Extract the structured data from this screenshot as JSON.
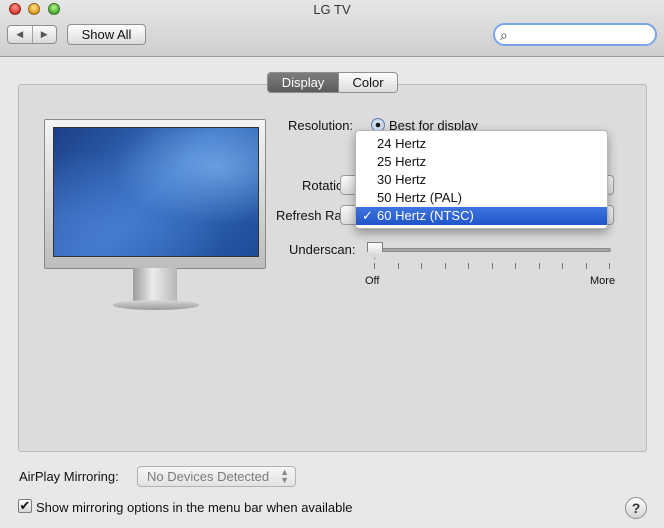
{
  "window": {
    "title": "LG TV"
  },
  "toolbar": {
    "back_glyph": "◀",
    "forward_glyph": "▶",
    "show_all_label": "Show All",
    "search_glyph": "⌕",
    "search_value": ""
  },
  "tabs": [
    {
      "label": "Display",
      "selected": true
    },
    {
      "label": "Color",
      "selected": false
    }
  ],
  "display": {
    "resolution_label": "Resolution:",
    "resolution_option": "Best for display",
    "rotation_label": "Rotation",
    "refresh_label": "Refresh Rate",
    "underscan_label": "Underscan:",
    "underscan_min": "Off",
    "underscan_max": "More",
    "underscan_value": 0
  },
  "refresh_menu": {
    "items": [
      {
        "label": "24 Hertz",
        "selected": false
      },
      {
        "label": "25 Hertz",
        "selected": false
      },
      {
        "label": "30 Hertz",
        "selected": false
      },
      {
        "label": "50 Hertz (PAL)",
        "selected": false
      },
      {
        "label": "60 Hertz (NTSC)",
        "selected": true
      }
    ],
    "check_glyph": "✓"
  },
  "footer": {
    "airplay_label": "AirPlay Mirroring:",
    "airplay_value": "No Devices Detected",
    "mirroring_checkbox_label": "Show mirroring options in the menu bar when available",
    "mirroring_checked": true,
    "check_glyph": "✔",
    "help_glyph": "?"
  }
}
